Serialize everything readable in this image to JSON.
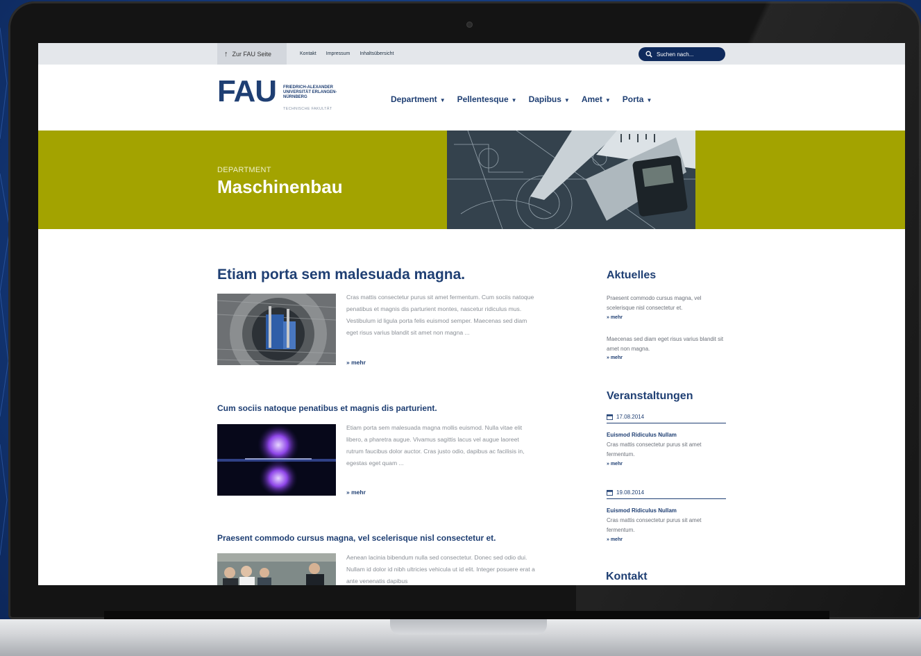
{
  "colors": {
    "brand_blue": "#1f3f73",
    "hero_olive": "#a3a300",
    "background_blue": "#14397a",
    "search_bg": "#0f2a5c"
  },
  "utility": {
    "home_label": "Zur FAU Seite",
    "links": [
      "Kontakt",
      "Impressum",
      "Inhaltsübersicht"
    ],
    "search_placeholder": "Suchen nach..."
  },
  "logo": {
    "word": "FAU",
    "subtitle": "FRIEDRICH-ALEXANDER UNIVERSITÄT ERLANGEN-NÜRNBERG",
    "faculty": "TECHNISCHE FAKULTÄT"
  },
  "nav": [
    {
      "label": "Department"
    },
    {
      "label": "Pellentesque"
    },
    {
      "label": "Dapibus"
    },
    {
      "label": "Amet"
    },
    {
      "label": "Porta"
    }
  ],
  "hero": {
    "kicker": "DEPARTMENT",
    "title": "Maschinenbau"
  },
  "main": {
    "featured": {
      "title": "Etiam porta sem malesuada magna.",
      "teaser": "Cras mattis consectetur purus sit amet fermentum. Cum sociis natoque penatibus et magnis dis parturient montes, nascetur ridiculus mus. Vestibulum id ligula porta felis euismod semper. Maecenas sed diam eget risus varius blandit sit amet non magna ...",
      "more": "» mehr"
    },
    "article2": {
      "title": "Cum sociis natoque penatibus et magnis dis parturient.",
      "teaser": "Etiam porta sem malesuada magna mollis euismod. Nulla vitae elit libero, a pharetra augue. Vivamus sagittis lacus vel augue laoreet rutrum faucibus dolor auctor. Cras justo odio, dapibus ac facilisis in, egestas eget quam ...",
      "more": "» mehr"
    },
    "article3": {
      "title": "Praesent commodo cursus magna, vel scelerisque nisl consectetur et.",
      "teaser": "Aenean lacinia bibendum nulla sed consectetur. Donec sed odio dui. Nullam id dolor id nibh ultricies vehicula ut id elit. Integer posuere erat a ante venenatis dapibus"
    }
  },
  "sidebar": {
    "news": {
      "heading": "Aktuelles",
      "items": [
        {
          "text": "Praesent commodo cursus magna, vel scelerisque nisl consectetur et.",
          "more": "» mehr"
        },
        {
          "text": "Maecenas sed diam eget risus varius blandit sit amet non magna.",
          "more": "» mehr"
        }
      ]
    },
    "events": {
      "heading": "Veranstaltungen",
      "items": [
        {
          "date": "17.08.2014",
          "title": "Euismod Ridiculus Nullam",
          "desc": "Cras mattis consectetur purus sit amet fermentum.",
          "more": "» mehr"
        },
        {
          "date": "19.08.2014",
          "title": "Euismod Ridiculus Nullam",
          "desc": "Cras mattis consectetur purus sit amet fermentum.",
          "more": "» mehr"
        }
      ]
    },
    "contact": {
      "heading": "Kontakt"
    }
  }
}
